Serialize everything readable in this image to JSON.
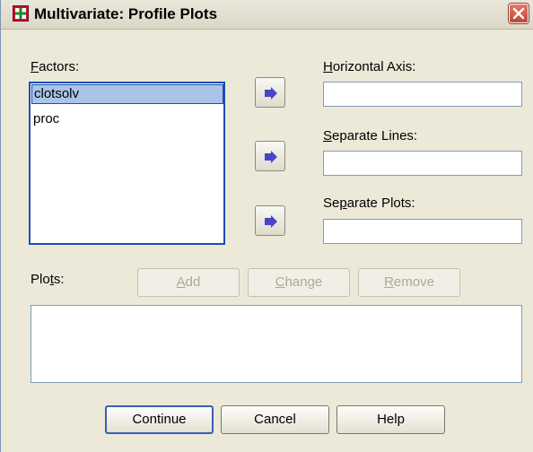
{
  "window": {
    "title": "Multivariate: Profile Plots",
    "colors": {
      "face": "#ece9d8",
      "accent": "#1c4fb3",
      "close": "#c24534"
    }
  },
  "factors": {
    "label": "Factors:",
    "mnemonic": "F",
    "label_rest": "actors:",
    "items": [
      {
        "label": "clotsolv",
        "selected": true
      },
      {
        "label": "proc",
        "selected": false
      }
    ]
  },
  "horizontal_axis": {
    "label_mn": "H",
    "label_rest": "orizontal Axis:",
    "value": ""
  },
  "separate_lines": {
    "label_mn": "S",
    "label_rest": "eparate Lines:",
    "value": ""
  },
  "separate_plots": {
    "label_pre": "Se",
    "label_mn": "p",
    "label_rest": "arate Plots:",
    "value": ""
  },
  "plots": {
    "label_pre": "Plo",
    "label_mn": "t",
    "label_rest": "s:",
    "items": []
  },
  "plot_buttons": {
    "add": {
      "mn": "A",
      "rest": "dd",
      "enabled": false
    },
    "change": {
      "mn": "C",
      "rest": "hange",
      "enabled": false
    },
    "remove": {
      "mn": "R",
      "rest": "emove",
      "enabled": false
    }
  },
  "footer": {
    "continue": "Continue",
    "cancel": "Cancel",
    "help": "Help"
  },
  "icons": {
    "app": "spss-dialog-icon",
    "close": "close-icon",
    "move_arrow": "arrow-right-icon"
  }
}
